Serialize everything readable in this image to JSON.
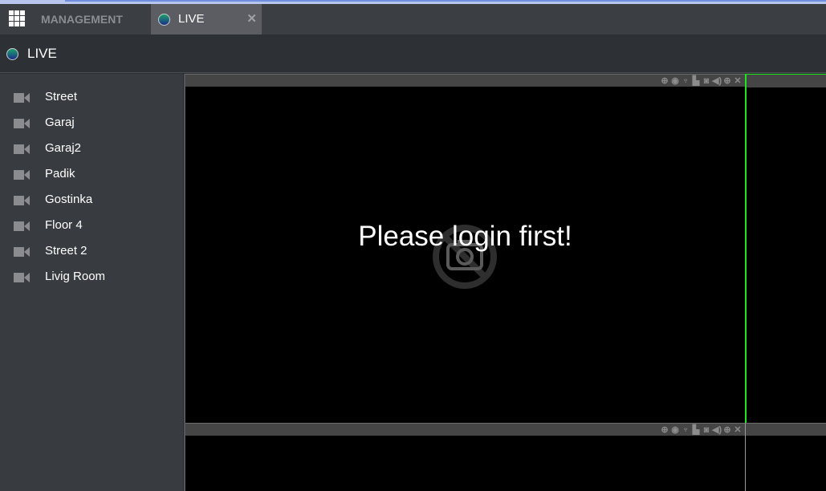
{
  "app": {
    "tabs": [
      {
        "label": "MANAGEMENT",
        "active": false
      },
      {
        "label": "LIVE",
        "active": true,
        "closable": true,
        "close_glyph": "✕"
      }
    ],
    "apps_icon": "grid-icon"
  },
  "header": {
    "title": "LIVE",
    "icon": "status-dot-icon"
  },
  "sidebar": {
    "items": [
      {
        "label": "Street",
        "icon": "video-camera-icon"
      },
      {
        "label": "Garaj",
        "icon": "video-camera-icon"
      },
      {
        "label": "Garaj2",
        "icon": "video-camera-icon"
      },
      {
        "label": "Padik",
        "icon": "video-camera-icon"
      },
      {
        "label": "Gostinka",
        "icon": "video-camera-icon"
      },
      {
        "label": "Floor 4",
        "icon": "video-camera-icon"
      },
      {
        "label": "Street 2",
        "icon": "video-camera-icon"
      },
      {
        "label": "Livig Room",
        "icon": "video-camera-icon"
      }
    ]
  },
  "video_grid": {
    "selected_pane": 2,
    "selected_color": "#1ee61e",
    "message": "Please login first!",
    "toolbar": [
      {
        "name": "ptz-icon",
        "glyph": "⊕"
      },
      {
        "name": "eye-icon",
        "glyph": "◉"
      },
      {
        "name": "microphone-icon",
        "glyph": "🎙"
      },
      {
        "name": "record-icon",
        "glyph": "▙"
      },
      {
        "name": "snapshot-icon",
        "glyph": "◙"
      },
      {
        "name": "audio-icon",
        "glyph": "◀)"
      },
      {
        "name": "zoom-in-icon",
        "glyph": "⊕"
      },
      {
        "name": "close-icon",
        "glyph": "✕"
      }
    ]
  }
}
